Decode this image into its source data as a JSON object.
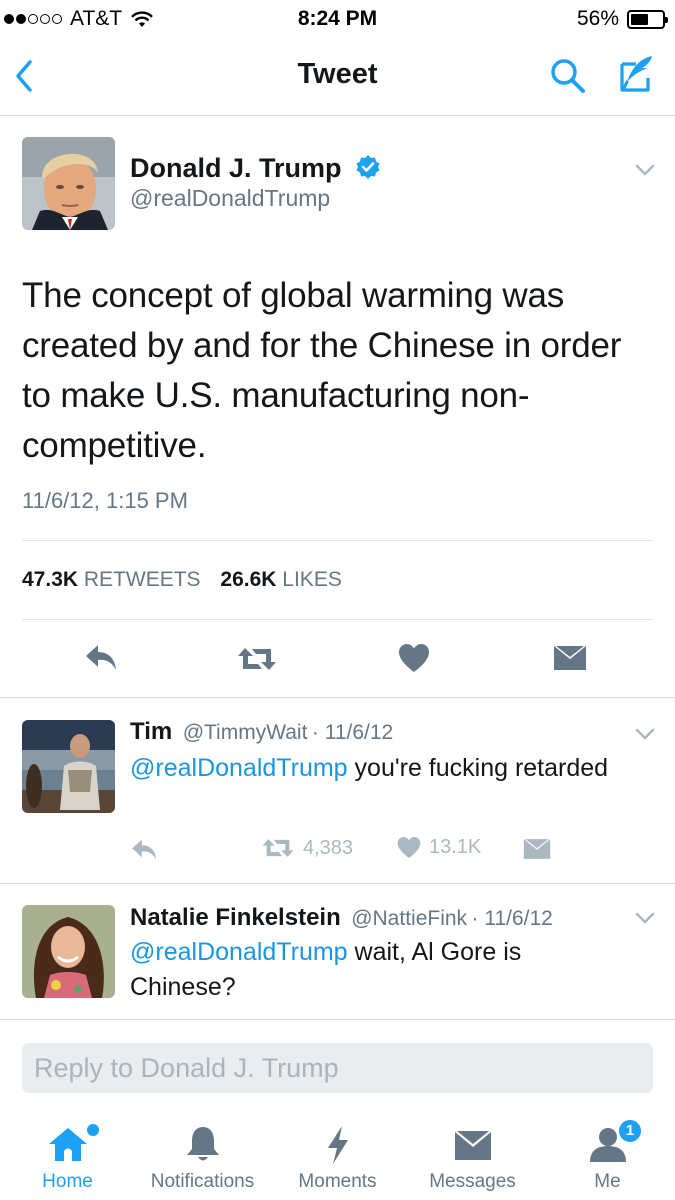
{
  "status_bar": {
    "carrier": "AT&T",
    "time": "8:24 PM",
    "battery": "56%",
    "battery_level": 0.56,
    "signal_bars": 2
  },
  "nav": {
    "title": "Tweet",
    "back_icon": "chevron-left-icon",
    "search_icon": "search-icon",
    "compose_icon": "compose-icon"
  },
  "tweet": {
    "author_name": "Donald J. Trump",
    "author_handle": "@realDonaldTrump",
    "verified": true,
    "text": "The concept of global warming was created by and for the Chinese in order to make U.S. manufacturing non-competitive.",
    "timestamp": "11/6/12, 1:15 PM",
    "retweets_count": "47.3K",
    "retweets_label": "RETWEETS",
    "likes_count": "26.6K",
    "likes_label": "LIKES"
  },
  "replies": [
    {
      "name": "Tim",
      "handle": "@TimmyWait",
      "date": "· 11/6/12",
      "mention": "@realDonaldTrump",
      "text": " you're fucking retarded",
      "retweets": "4,383",
      "likes": "13.1K"
    },
    {
      "name": "Natalie Finkelstein",
      "handle": "@NattieFink",
      "date": "· 11/6/12",
      "mention": "@realDonaldTrump",
      "text": " wait, Al Gore is Chinese?"
    }
  ],
  "reply_box": {
    "placeholder": "Reply to Donald J. Trump"
  },
  "tab_bar": {
    "tabs": [
      {
        "label": "Home",
        "icon": "home-icon",
        "active": true
      },
      {
        "label": "Notifications",
        "icon": "bell-icon"
      },
      {
        "label": "Moments",
        "icon": "lightning-icon"
      },
      {
        "label": "Messages",
        "icon": "envelope-icon"
      },
      {
        "label": "Me",
        "icon": "person-icon",
        "badge": "1"
      }
    ]
  },
  "colors": {
    "accent": "#1da1f2",
    "mention": "#1b95e0",
    "text": "#14171a",
    "muted": "#657786",
    "icon_gray": "#8899a6"
  }
}
